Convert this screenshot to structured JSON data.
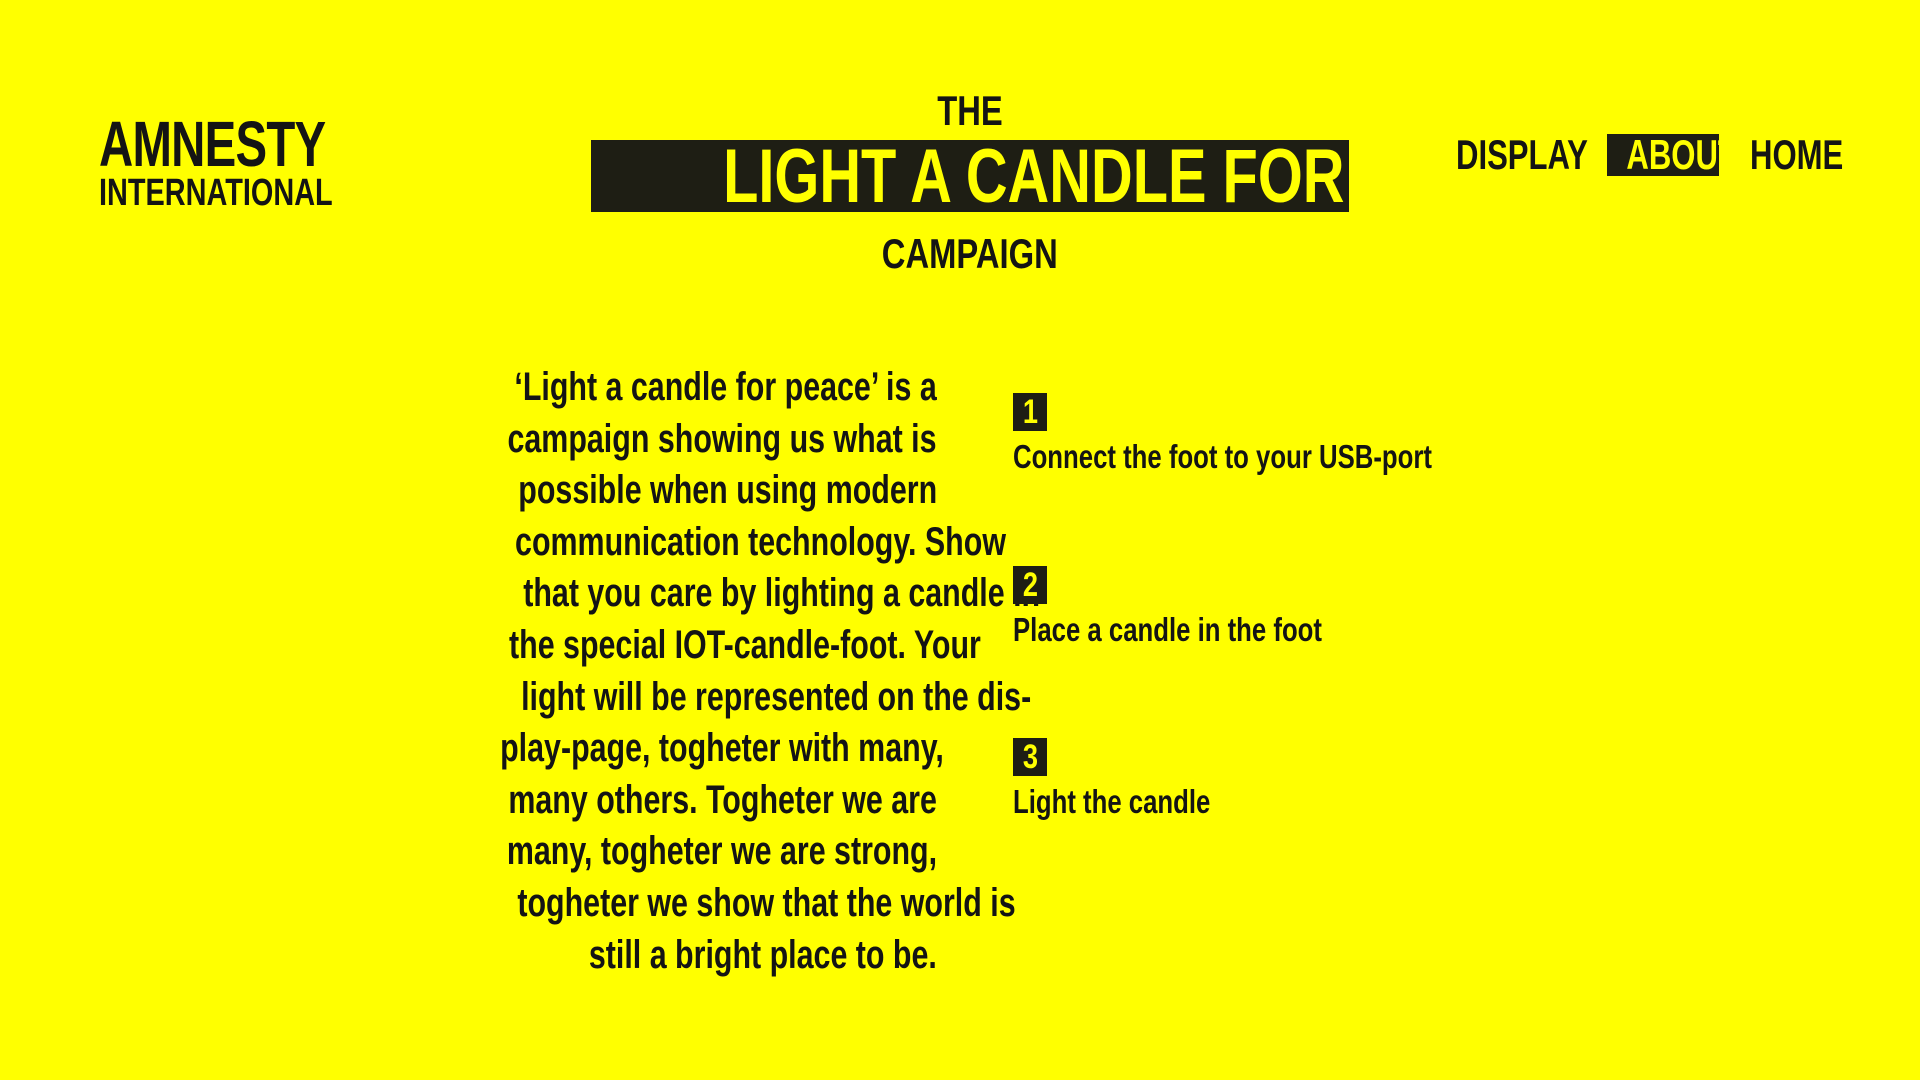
{
  "colors": {
    "background": "#FFFF00",
    "ink": "#141414",
    "highlight": "#1E1E14"
  },
  "logo": {
    "line1": "AMNESTY",
    "line2": "INTERNATIONAL"
  },
  "title": {
    "pre": "THE",
    "main": "LIGHT A CANDLE FOR PEACE",
    "post": "CAMPAIGN"
  },
  "nav": {
    "display": "DISPLAY",
    "about": "ABOUT",
    "home": "HOME",
    "active": "ABOUT"
  },
  "description": {
    "lines": [
      "‘Light a candle for peace’ is a",
      "campaign showing us what is",
      "possible when using modern",
      "communication technology. Show",
      "that you care by lighting a candle in",
      "the special IOT-candle-foot. Your",
      "light will be represented on the dis-",
      "play-page, togheter with many,",
      "many others. Togheter we are",
      "many, togheter we are strong,",
      "togheter we show that the world is",
      "still a bright place to be."
    ]
  },
  "steps": [
    {
      "number": "1",
      "text": "Connect the foot to your USB-port"
    },
    {
      "number": "2",
      "text": "Place a candle in the foot"
    },
    {
      "number": "3",
      "text": "Light the candle"
    }
  ]
}
